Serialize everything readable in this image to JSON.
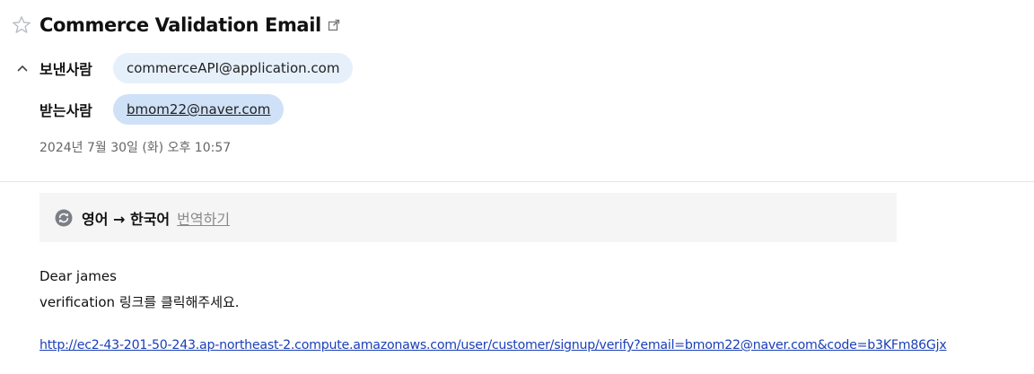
{
  "header": {
    "subject": "Commerce Validation Email",
    "star_icon": "star-outline-icon",
    "popout_icon": "open-in-new-window-icon"
  },
  "sender": {
    "label": "보낸사람",
    "address": "commerceAPI@application.com"
  },
  "recipient": {
    "label": "받는사람",
    "address": "bmom22@naver.com"
  },
  "date": "2024년 7월 30일 (화) 오후 10:57",
  "translate_bar": {
    "icon": "translate-refresh-icon",
    "lang_pair": "영어 → 한국어",
    "action": "번역하기"
  },
  "body": {
    "greeting": "Dear james",
    "instruction": "verification 링크를 클릭해주세요.",
    "link": "http://ec2-43-201-50-243.ap-northeast-2.compute.amazonaws.com/user/customer/signup/verify?email=bmom22@naver.com&code=b3KFm86Gjx"
  },
  "colors": {
    "sender_chip": "#e6f0fb",
    "recipient_chip": "#cfe1f7",
    "link": "#1a3fb7",
    "translate_bar_bg": "#f5f5f6"
  }
}
